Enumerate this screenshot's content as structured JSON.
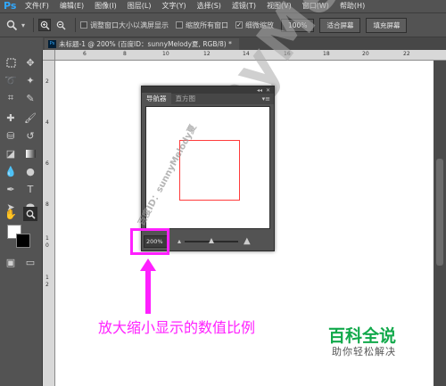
{
  "menubar": {
    "logo": "Ps",
    "items": [
      "文件(F)",
      "编辑(E)",
      "图像(I)",
      "图层(L)",
      "文字(Y)",
      "选择(S)",
      "滤镜(T)",
      "视图(V)",
      "窗口(W)",
      "帮助(H)"
    ]
  },
  "options": {
    "resize_windows": "调整窗口大小以满屏显示",
    "zoom_all_windows": "缩放所有窗口",
    "scrubby_zoom": "细微缩放",
    "btn_100": "100%",
    "btn_fit": "适合屏幕",
    "btn_fill": "填充屏幕",
    "scrubby_checked": true
  },
  "document": {
    "tab_title": "未标题-1 @ 200% (百度ID：sunnyMelody夏, RGB/8) *"
  },
  "rulers": {
    "top": [
      "6",
      "8",
      "10",
      "12",
      "14",
      "16",
      "18",
      "20",
      "22"
    ],
    "left": [
      "2",
      "4",
      "6",
      "8",
      "1",
      "0",
      "1",
      "2"
    ]
  },
  "navigator": {
    "tabs": [
      "导航器",
      "直方图"
    ],
    "zoom_value": "200%",
    "zoom_level": 0.5,
    "view_box_color": "#ff3b3b"
  },
  "watermark": {
    "big": "sunnyMel",
    "small": "百度ID：sunnyMelody夏"
  },
  "annotation": {
    "text": "放大缩小显示的数值比例",
    "color": "#ff20ff"
  },
  "brand": {
    "name": "百科全说",
    "tagline": "助你轻松解决",
    "color": "#12a94b"
  }
}
